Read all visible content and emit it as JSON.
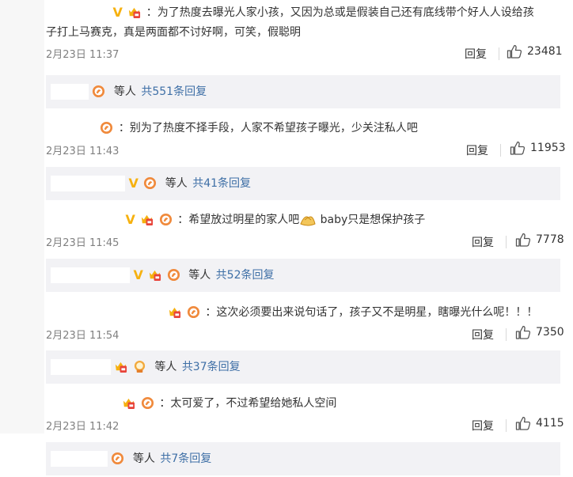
{
  "comments": [
    {
      "text_line1": "：为了热度去曝光人家小孩，又因为总或是假装自己还有底线带个好人人设给孩",
      "text_line2": "子打上马赛克，真是两面都不讨好啊，可笑，假聪明",
      "time": "2月23日 11:37",
      "reply_label": "回复",
      "likes": "23481",
      "summary": {
        "etc": "等人",
        "more": "共551条回复"
      }
    },
    {
      "text": "：别为了热度不择手段，人家不希望孩子曝光，少关注私人吧",
      "time": "2月23日 11:43",
      "reply_label": "回复",
      "likes": "11953",
      "summary": {
        "etc": "等人",
        "more": "共41条回复"
      }
    },
    {
      "text_a": "：希望放过明星的家人吧",
      "text_b": " baby只是想保护孩子",
      "time": "2月23日 11:45",
      "reply_label": "回复",
      "likes": "7778",
      "summary": {
        "etc": "等人",
        "more": "共52条回复"
      }
    },
    {
      "text": "：这次必须要出来说句话了，孩子又不是明星，瞎曝光什么呢！！！",
      "time": "2月23日 11:54",
      "reply_label": "回复",
      "likes": "7350",
      "summary": {
        "etc": "等人",
        "more": "共37条回复"
      }
    },
    {
      "text": "：太可爱了，不过希望给她私人空间",
      "time": "2月23日 11:42",
      "reply_label": "回复",
      "likes": "4115",
      "summary": {
        "etc": "等人",
        "more": "共7条回复"
      }
    }
  ],
  "colors": {
    "link": "#3e6fa6",
    "summary_bg": "#f2f2f5",
    "time": "#808080",
    "vip": "#f6b10f"
  }
}
